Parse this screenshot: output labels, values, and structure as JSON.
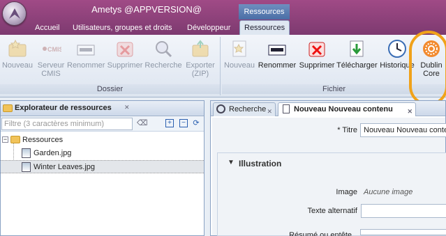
{
  "app": {
    "title": "Ametys @APPVERSION@"
  },
  "context_group": {
    "label": "Ressources"
  },
  "tabs": [
    {
      "label": "Accueil"
    },
    {
      "label": "Utilisateurs, groupes et droits"
    },
    {
      "label": "Développeur"
    },
    {
      "label": "Ressources"
    }
  ],
  "ribbon": {
    "dossier": {
      "label": "Dossier",
      "buttons": [
        {
          "label": "Nouveau",
          "icon": "new-folder-icon"
        },
        {
          "label": "Serveur CMIS",
          "icon": "cmis-icon"
        },
        {
          "label": "Renommer",
          "icon": "rename-icon"
        },
        {
          "label": "Supprimer",
          "icon": "delete-icon"
        },
        {
          "label": "Recherche",
          "icon": "search-icon"
        },
        {
          "label": "Exporter (ZIP)",
          "icon": "export-zip-icon"
        }
      ]
    },
    "fichier": {
      "label": "Fichier",
      "buttons": [
        {
          "label": "Nouveau",
          "icon": "new-file-icon"
        },
        {
          "label": "Renommer",
          "icon": "rename-icon"
        },
        {
          "label": "Supprimer",
          "icon": "delete-icon"
        },
        {
          "label": "Télécharger",
          "icon": "download-icon"
        },
        {
          "label": "Historique",
          "icon": "clock-icon"
        },
        {
          "label": "Dublin Core",
          "icon": "dublin-core-icon"
        }
      ]
    }
  },
  "explorer": {
    "title": "Explorateur de ressources",
    "filter_placeholder": "Filtre (3 caractères minimum)",
    "tree": {
      "root": "Ressources",
      "children": [
        "Garden.jpg",
        "Winter Leaves.jpg"
      ]
    }
  },
  "right_tabs": [
    {
      "label": "Recherche"
    },
    {
      "label": "Nouveau Nouveau contenu"
    }
  ],
  "form": {
    "title_label": "* Titre",
    "title_value": "Nouveau Nouveau contenu",
    "section_title": "Illustration",
    "image_label": "Image",
    "image_value": "Aucune image",
    "alt_label": "Texte alternatif",
    "summary_label": "Résumé ou entête"
  },
  "colors": {
    "title_bar": "#8f4480",
    "context_group": "#5577ae",
    "highlight": "#f0a21a"
  }
}
